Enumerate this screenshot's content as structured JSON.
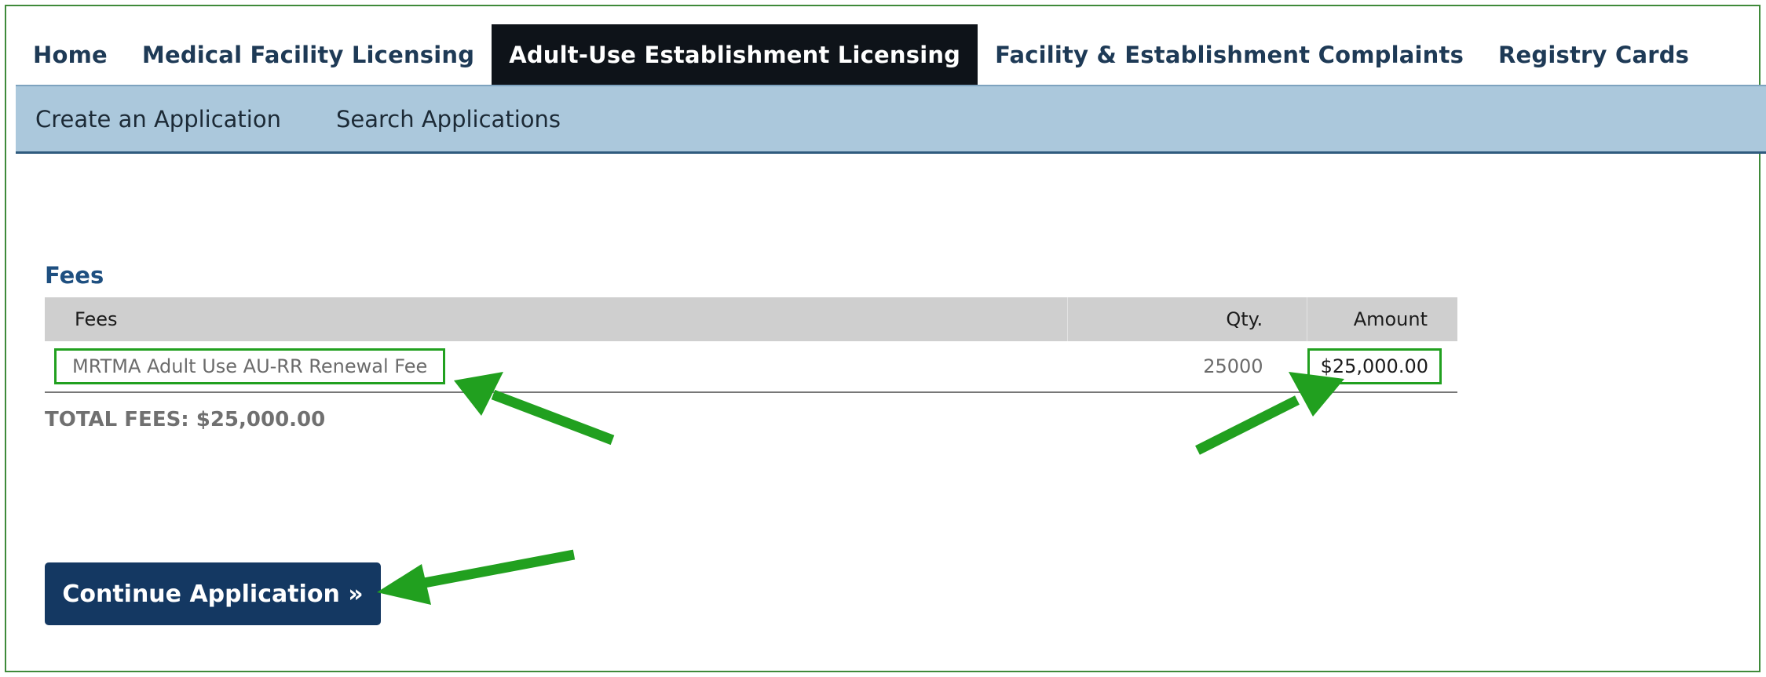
{
  "main_nav": {
    "tabs": [
      {
        "label": "Home"
      },
      {
        "label": "Medical Facility Licensing"
      },
      {
        "label": "Adult-Use Establishment Licensing",
        "active": true
      },
      {
        "label": "Facility & Establishment Complaints"
      },
      {
        "label": "Registry Cards"
      }
    ]
  },
  "sub_nav": {
    "items": [
      {
        "label": "Create an Application"
      },
      {
        "label": "Search Applications"
      }
    ]
  },
  "fees": {
    "heading": "Fees",
    "columns": {
      "fees": "Fees",
      "qty": "Qty.",
      "amount": "Amount"
    },
    "rows": [
      {
        "description": "MRTMA Adult Use AU-RR Renewal Fee",
        "qty": "25000",
        "amount": "$25,000.00"
      }
    ],
    "total": "TOTAL FEES: $25,000.00"
  },
  "actions": {
    "continue_label": "Continue Application »"
  },
  "colors": {
    "annotation_green": "#21a01f",
    "button_navy": "#143862",
    "subnav_blue": "#abc8dc",
    "active_tab": "#0e1319"
  }
}
